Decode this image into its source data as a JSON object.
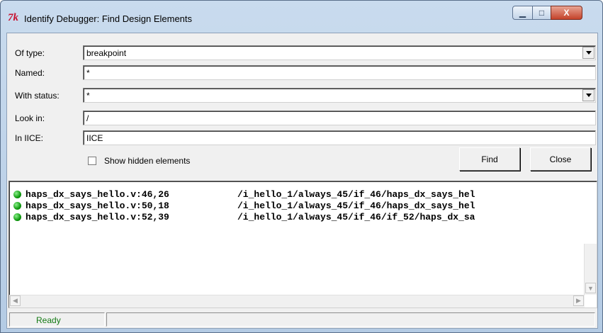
{
  "window": {
    "icon_text": "7k",
    "title": "Identify Debugger: Find Design Elements",
    "minimize_symbol": "▁",
    "maximize_symbol": "□",
    "close_symbol": "X"
  },
  "form": {
    "of_type": {
      "label": "Of type:",
      "value": "breakpoint"
    },
    "named": {
      "label": "Named:",
      "value": "*"
    },
    "with_status": {
      "label": "With status:",
      "value": "*"
    },
    "look_in": {
      "label": "Look in:",
      "value": "/"
    },
    "in_iice": {
      "label": "In IICE:",
      "value": "IICE"
    },
    "show_hidden": {
      "label": "Show hidden elements",
      "checked": false
    }
  },
  "buttons": {
    "find": "Find",
    "close": "Close"
  },
  "results": [
    {
      "location": "haps_dx_says_hello.v:46,26",
      "path": "/i_hello_1/always_45/if_46/haps_dx_says_hel",
      "status_color": "#11a011"
    },
    {
      "location": "haps_dx_says_hello.v:50,18",
      "path": "/i_hello_1/always_45/if_46/haps_dx_says_hel",
      "status_color": "#11a011"
    },
    {
      "location": "haps_dx_says_hello.v:52,39",
      "path": "/i_hello_1/always_45/if_46/if_52/haps_dx_sa",
      "status_color": "#11a011"
    }
  ],
  "status_bar": {
    "state": "Ready",
    "message": ""
  }
}
